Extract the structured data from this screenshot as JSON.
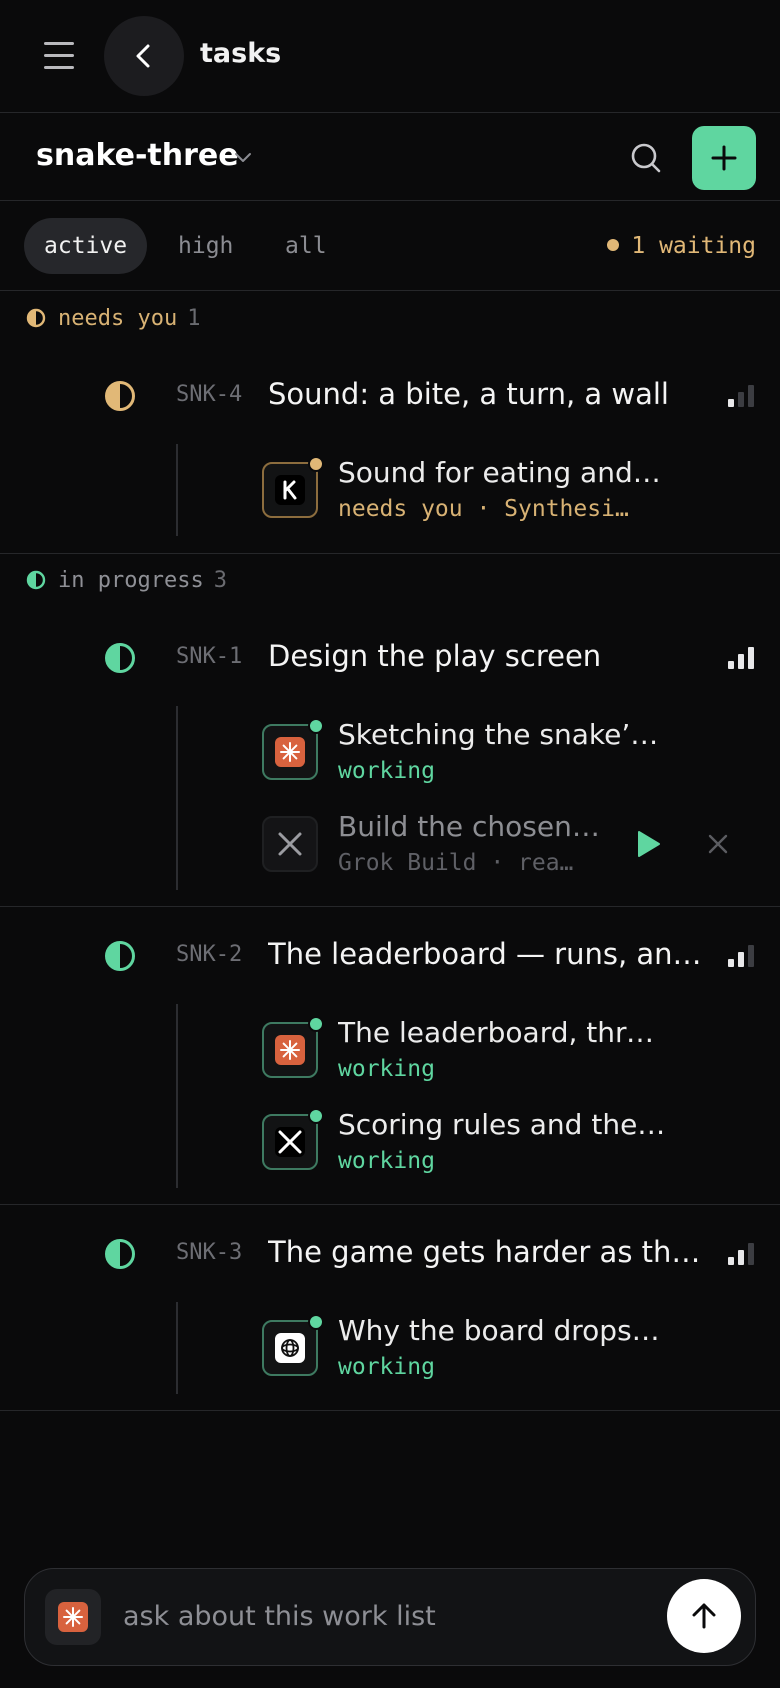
{
  "colors": {
    "accent": "#5fd6a0",
    "waiting": "#e1b877",
    "background": "#0a0a0b"
  },
  "header": {
    "title": "tasks"
  },
  "project": {
    "name": "snake-three"
  },
  "filters": {
    "active": "active",
    "high": "high",
    "all": "all",
    "waiting": "1 waiting"
  },
  "sections": {
    "needs_you": {
      "label": "needs you",
      "count": "1"
    },
    "in_progress": {
      "label": "in progress",
      "count": "3"
    }
  },
  "tasks": [
    {
      "id": "SNK-4",
      "title": "Sound: a bite, a turn, a wall",
      "priority_level": 1,
      "runs": [
        {
          "agent_icon": "k-icon",
          "title": "Sound for eating and…",
          "status": "needs you · Synthesi…"
        }
      ]
    },
    {
      "id": "SNK-1",
      "title": "Design the play screen",
      "priority_level": 3,
      "runs": [
        {
          "agent_icon": "sparkle-icon",
          "title": "Sketching the snake’…",
          "status": "working"
        },
        {
          "agent_icon": "x-logo-icon",
          "title": "Build the chosen…",
          "status": "Grok Build · rea…"
        }
      ]
    },
    {
      "id": "SNK-2",
      "title": "The leaderboard — runs, an…",
      "priority_level": 2,
      "runs": [
        {
          "agent_icon": "sparkle-icon",
          "title": "The leaderboard, thro…",
          "status": "working"
        },
        {
          "agent_icon": "x-logo-icon",
          "title": "Scoring rules and the…",
          "status": "working"
        }
      ]
    },
    {
      "id": "SNK-3",
      "title": "The game gets harder as th…",
      "priority_level": 2,
      "runs": [
        {
          "agent_icon": "knot-icon",
          "title": "Why the board drops…",
          "status": "working"
        }
      ]
    }
  ],
  "composer": {
    "placeholder": "ask about this work list"
  }
}
